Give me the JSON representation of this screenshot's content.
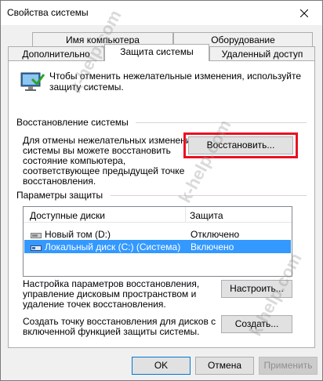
{
  "window": {
    "title": "Свойства системы"
  },
  "tabs": {
    "row1": [
      "Имя компьютера",
      "Оборудование"
    ],
    "row2": [
      "Дополнительно",
      "Защита системы",
      "Удаленный доступ"
    ]
  },
  "intro": {
    "line1": "Чтобы отменить нежелательные изменения, используйте",
    "line2": "защиту системы."
  },
  "restore": {
    "header": "Восстановление системы",
    "desc": [
      "Для отмены нежелательных изменений",
      "системы вы можете восстановить",
      "состояние компьютера,",
      "соответствующее предыдущей точке",
      "восстановления."
    ],
    "button": "Восстановить..."
  },
  "protection": {
    "header": "Параметры защиты",
    "col_disks": "Доступные диски",
    "col_protection": "Защита",
    "rows": [
      {
        "disk": "Новый том (D:)",
        "status": "Отключено"
      },
      {
        "disk": "Локальный диск (C:) (Система)",
        "status": "Включено"
      }
    ]
  },
  "configure": {
    "desc": [
      "Настройка параметров восстановления,",
      "управление дисковым пространством и",
      "удаление точек восстановления."
    ],
    "button": "Настроить..."
  },
  "create": {
    "desc": [
      "Создать точку восстановления для дисков с",
      "включенной функцией защиты системы."
    ],
    "button": "Создать..."
  },
  "footer": {
    "ok": "OK",
    "cancel": "Отмена",
    "apply": "Применить"
  },
  "watermark": [
    "k-help.com",
    "k-help.com",
    "k-help.com"
  ],
  "colors": {
    "selection": "#3399ff",
    "highlight_frame": "#e81123",
    "default_button_border": "#0078d7"
  }
}
